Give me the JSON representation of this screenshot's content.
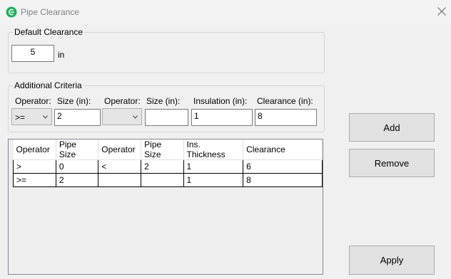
{
  "window": {
    "title": "Pipe Clearance",
    "accent": "#1aaf5d"
  },
  "default_clearance": {
    "legend": "Default Clearance",
    "value": "5",
    "unit": "in"
  },
  "additional": {
    "legend": "Additional Criteria",
    "labels": {
      "operator1": "Operator:",
      "size1": "Size (in):",
      "operator2": "Operator:",
      "size2": "Size (in):",
      "insulation": "Insulation (in):",
      "clearance": "Clearance (in):"
    },
    "values": {
      "operator1": ">=",
      "size1": "2",
      "operator2": "",
      "size2": "",
      "insulation": "1",
      "clearance": "8"
    }
  },
  "table": {
    "headers": [
      "Operator",
      "Pipe Size",
      "Operator",
      "Pipe Size",
      "Ins. Thickness",
      "Clearance"
    ],
    "rows": [
      [
        ">",
        "0",
        "<",
        "2",
        "1",
        "6"
      ],
      [
        ">=",
        "2",
        "",
        "",
        "1",
        "8"
      ]
    ]
  },
  "buttons": {
    "add": "Add",
    "remove": "Remove",
    "apply": "Apply"
  }
}
